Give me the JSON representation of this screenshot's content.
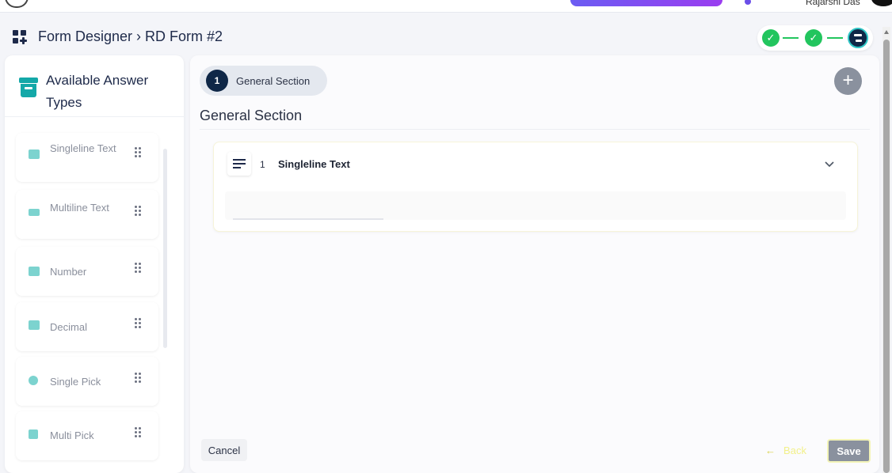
{
  "topbar": {
    "user_name": "Rajarshi Das"
  },
  "header": {
    "title": "Form Designer › RD Form #2",
    "stepper": {
      "total_steps": 3,
      "completed_steps": 2,
      "current_step": 3
    }
  },
  "sidebar": {
    "title": "Available Answer Types",
    "items": [
      {
        "label": "Singleline Text",
        "icon": "text-type-icon"
      },
      {
        "label": "Multiline Text",
        "icon": "lines-icon"
      },
      {
        "label": "Number",
        "icon": "number-icon"
      },
      {
        "label": "Decimal",
        "icon": "calculator-icon"
      },
      {
        "label": "Single Pick",
        "icon": "radio-icon"
      },
      {
        "label": "Multi Pick",
        "icon": "checkbox-icon"
      }
    ]
  },
  "main": {
    "section_tab": {
      "number": "1",
      "label": "General Section"
    },
    "section_heading": "General Section",
    "questions": [
      {
        "number": "1",
        "label": "Singleline Text",
        "icon": "short-text-icon"
      }
    ],
    "actions": {
      "cancel": "Cancel",
      "back": "Back",
      "save": "Save"
    }
  },
  "colors": {
    "primary_dark": "#0f2747",
    "teal_accent": "#14a8a8",
    "success": "#22c55e",
    "save_button": "#8a919e"
  }
}
